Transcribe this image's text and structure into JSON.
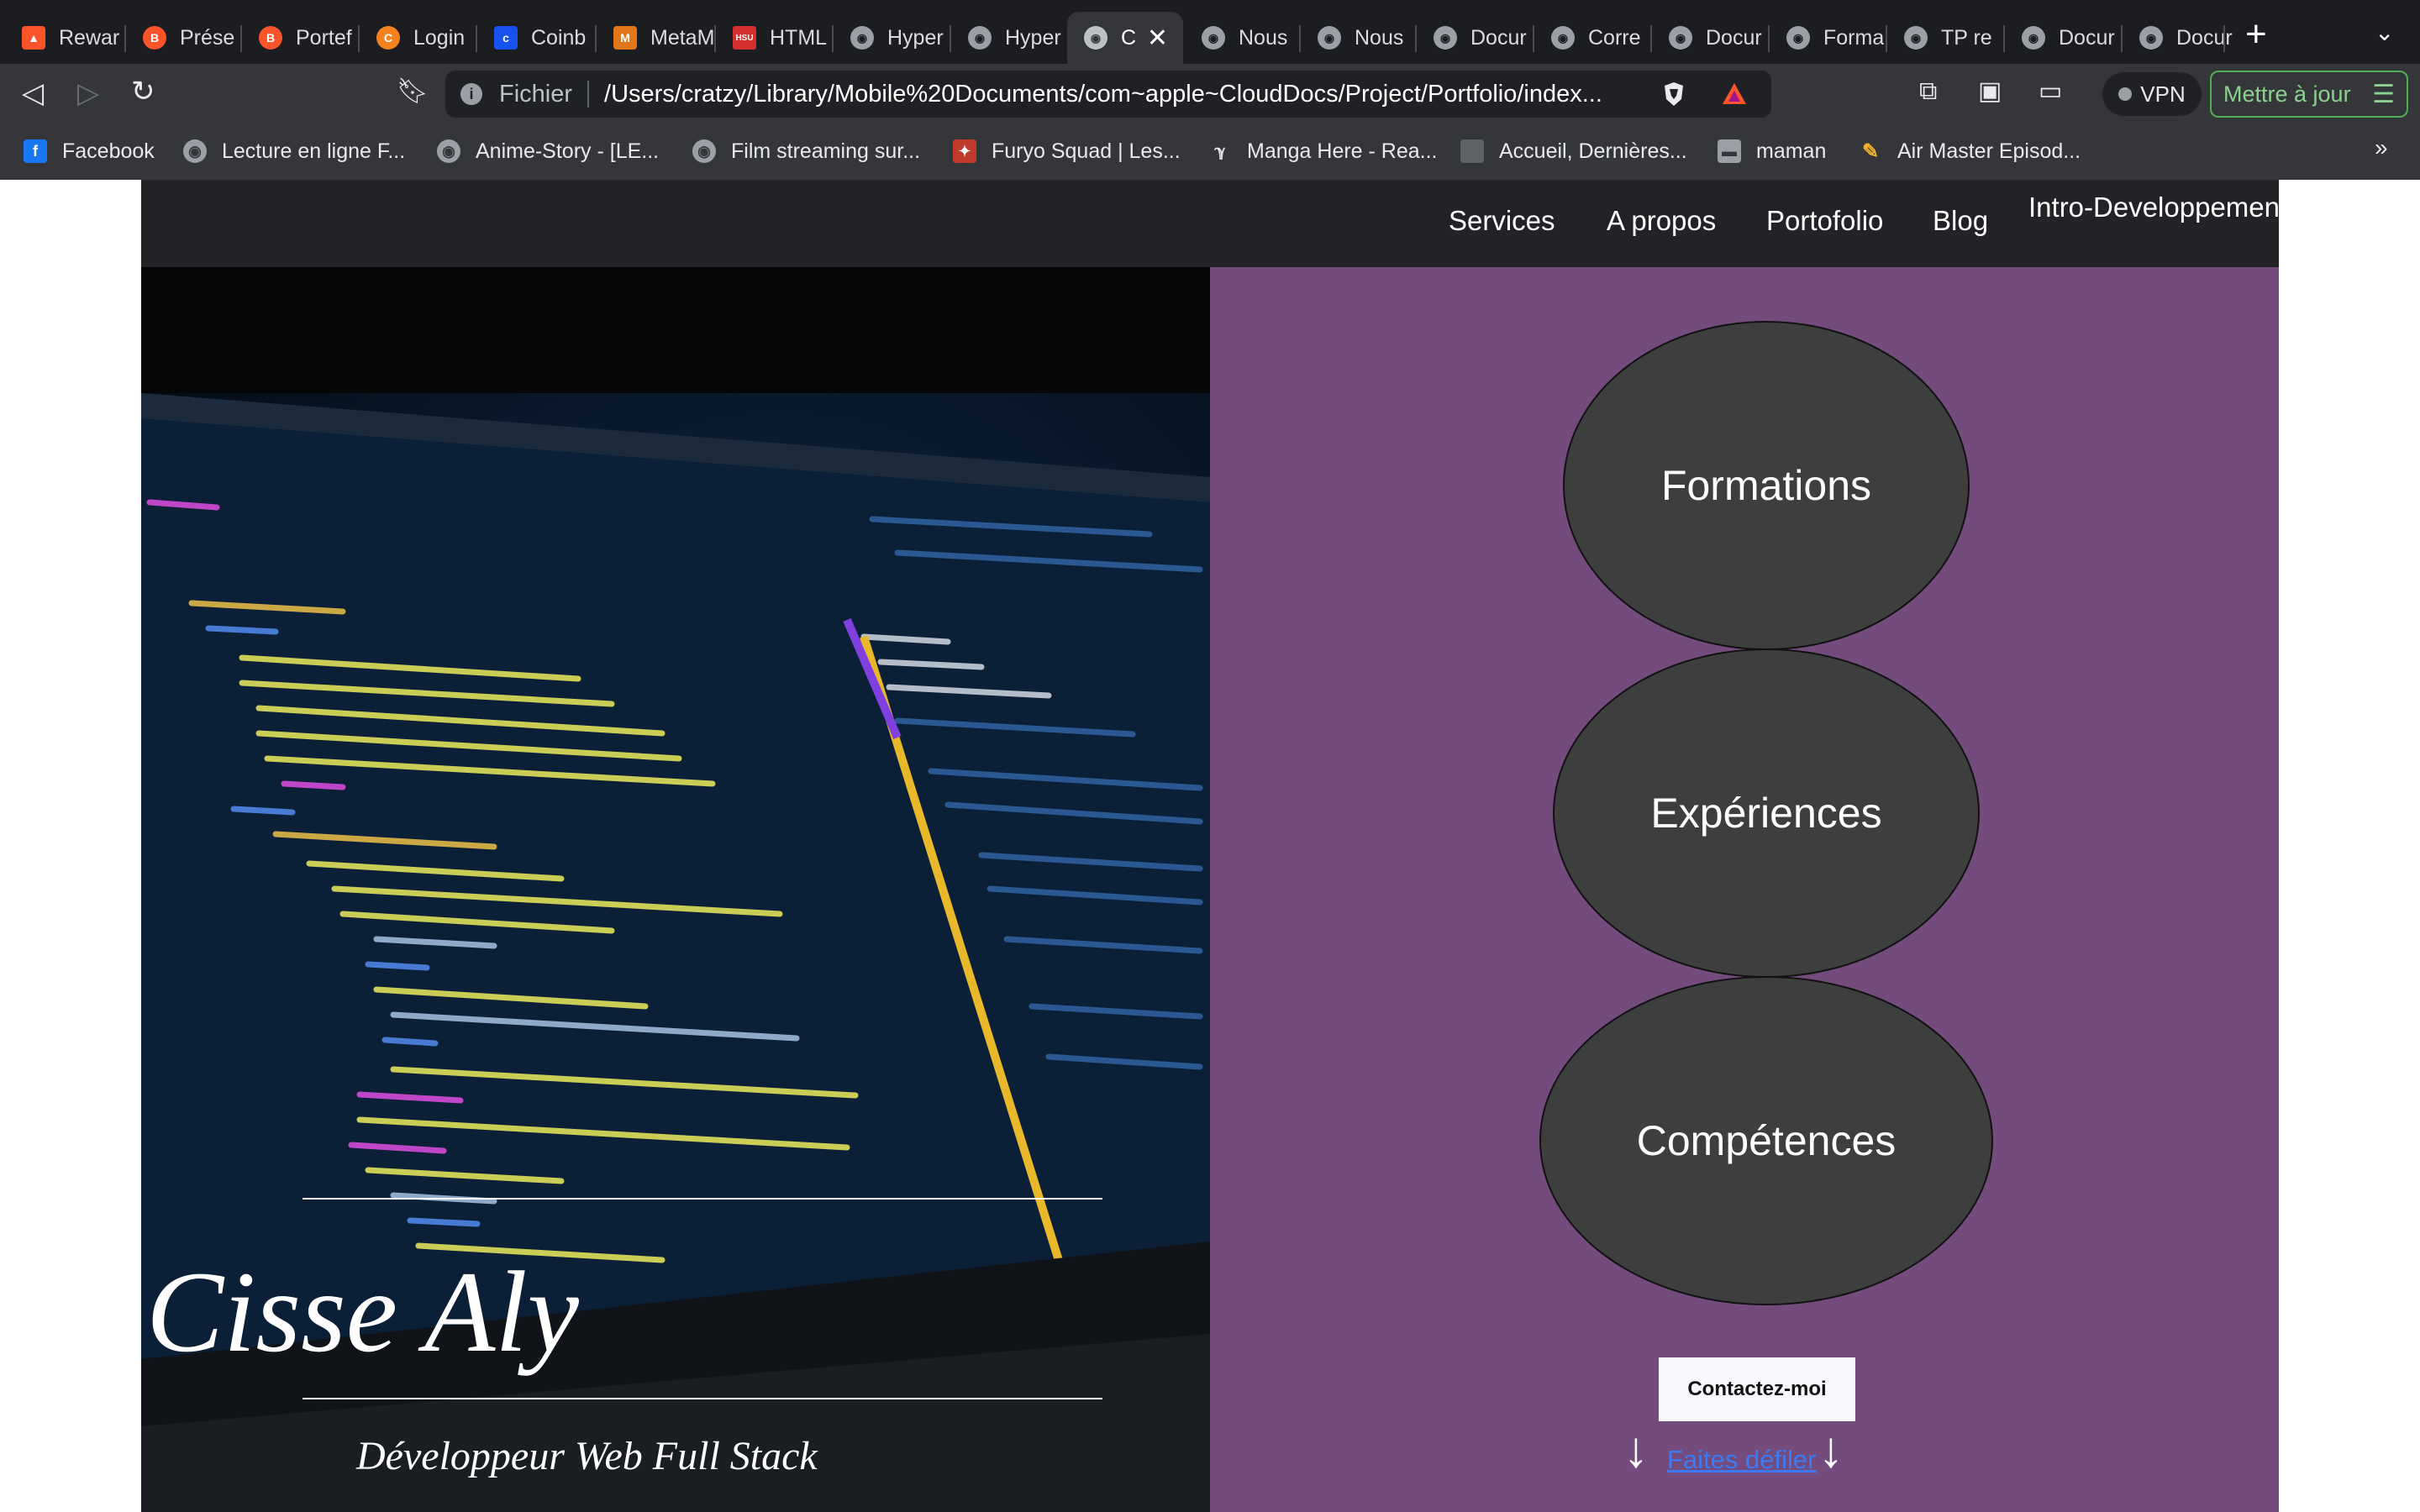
{
  "browser": {
    "tabs": [
      {
        "title": "Rewar",
        "icon": "brave-rewards-icon"
      },
      {
        "title": "Prése",
        "icon": "brave-icon"
      },
      {
        "title": "Portef",
        "icon": "brave-icon"
      },
      {
        "title": "Login",
        "icon": "coinbase-login-icon"
      },
      {
        "title": "Coinb",
        "icon": "coinbase-icon"
      },
      {
        "title": "MetaM",
        "icon": "metamask-icon"
      },
      {
        "title": "HTML",
        "icon": "hsu-icon"
      },
      {
        "title": "Hyper",
        "icon": "globe-icon"
      },
      {
        "title": "Hyper",
        "icon": "globe-icon"
      },
      {
        "title": "C",
        "icon": "globe-icon",
        "active": true
      },
      {
        "title": "Nous",
        "icon": "globe-icon"
      },
      {
        "title": "Nous",
        "icon": "globe-icon"
      },
      {
        "title": "Docur",
        "icon": "globe-icon"
      },
      {
        "title": "Corre",
        "icon": "globe-icon"
      },
      {
        "title": "Docur",
        "icon": "globe-icon"
      },
      {
        "title": "Forma",
        "icon": "globe-icon"
      },
      {
        "title": "TP re",
        "icon": "globe-icon"
      },
      {
        "title": "Docur",
        "icon": "globe-icon"
      },
      {
        "title": "Docur",
        "icon": "globe-icon"
      }
    ],
    "address": {
      "scheme_label": "Fichier",
      "path": "/Users/cratzy/Library/Mobile%20Documents/com~apple~CloudDocs/Project/Portfolio/index..."
    },
    "vpn_label": "VPN",
    "update_label": "Mettre à jour",
    "bookmarks": [
      {
        "label": "Facebook",
        "icon": "facebook-icon"
      },
      {
        "label": "Lecture en ligne F...",
        "icon": "globe-icon"
      },
      {
        "label": "Anime-Story - [LE...",
        "icon": "globe-icon"
      },
      {
        "label": "Film streaming sur...",
        "icon": "globe-icon"
      },
      {
        "label": "Furyo Squad | Les...",
        "icon": "furyo-icon"
      },
      {
        "label": "Manga Here - Rea...",
        "icon": "manga-icon"
      },
      {
        "label": "Accueil, Dernières...",
        "icon": "page-icon"
      },
      {
        "label": "maman",
        "icon": "folder-icon"
      },
      {
        "label": "Air Master Episod...",
        "icon": "pencil-icon"
      }
    ]
  },
  "site": {
    "nav": [
      "Services",
      "A propos",
      "Portofolio",
      "Blog",
      "Intro-Developpement"
    ],
    "hero": {
      "name": "Cisse Aly",
      "role": "Développeur Web Full Stack"
    },
    "bubbles": [
      "Formations",
      "Expériences",
      "Compétences"
    ],
    "contact_label": "Contactez-moi",
    "scroll_label": "Faites défiler"
  },
  "colors": {
    "navbar": "#222326",
    "hero_right": "#734b7c",
    "bubble": "#3d3f3f",
    "link": "#3c7bf5"
  }
}
